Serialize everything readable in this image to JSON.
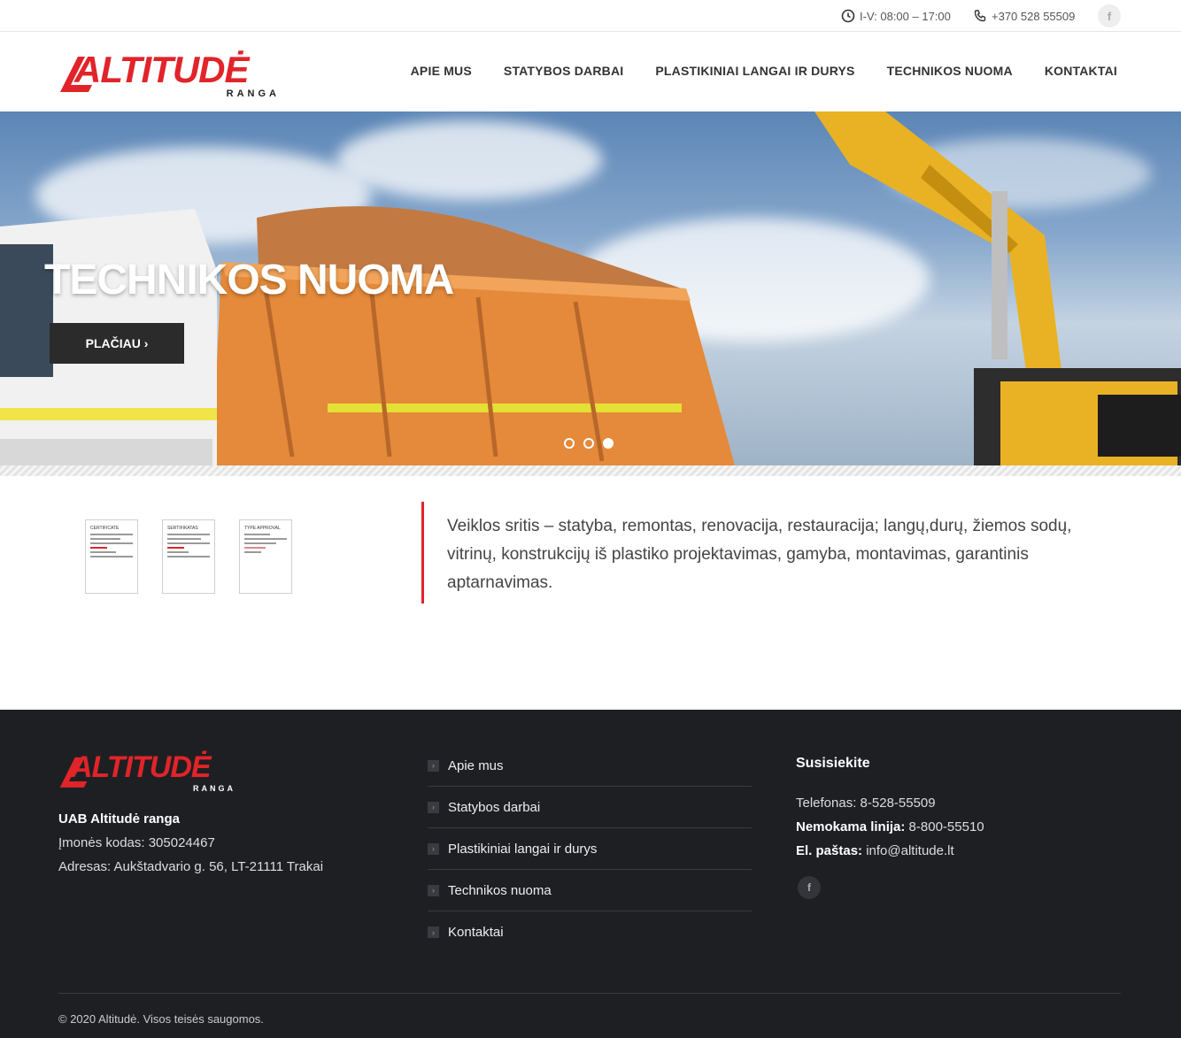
{
  "topbar": {
    "hours": "I-V: 08:00 – 17:00",
    "phone": "+370 528 55509",
    "facebook": "f"
  },
  "header": {
    "logo_main": "ALTITUDĖ",
    "logo_sub": "RANGA",
    "nav": [
      "APIE MUS",
      "STATYBOS DARBAI",
      "PLASTIKINIAI LANGAI IR DURYS",
      "TECHNIKOS NUOMA",
      "KONTAKTAI"
    ]
  },
  "hero": {
    "title": "TECHNIKOS NUOMA",
    "button": "PLAČIAU ›",
    "slides_total": 3,
    "active_slide": 3
  },
  "content": {
    "certificates": [
      "CERTIFICATE",
      "SERTIFIKATAS",
      "TYPE APPROVAL"
    ],
    "about": "Veiklos sritis – statyba, remontas, renovacija, restauracija; langų,durų, žiemos sodų, vitrinų, konstrukcijų iš plastiko projektavimas, gamyba, montavimas, garantinis aptarnavimas."
  },
  "footer": {
    "logo_main": "ALTITUDĖ",
    "logo_sub": "RANGA",
    "company_name": "UAB Altitudė ranga",
    "company_code": "Įmonės kodas: 305024467",
    "address": "Adresas: Aukštadvario g. 56, LT-21111 Trakai",
    "links": [
      "Apie mus",
      "Statybos darbai",
      "Plastikiniai langai ir durys",
      "Technikos nuoma",
      "Kontaktai"
    ],
    "contact_title": "Susisiekite",
    "phone": "Telefonas: 8-528-55509",
    "free_line_label": "Nemokama linija:",
    "free_line_value": " 8-800-55510",
    "email_label": "El. paštas:",
    "email_value": " info@altitude.lt",
    "facebook": "f",
    "copyright": "© 2020 Altitudė. Visos teisės saugomos."
  },
  "colors": {
    "accent": "#e1242a",
    "footer_bg": "#1e1f23",
    "button_bg": "#2b2b2b"
  }
}
